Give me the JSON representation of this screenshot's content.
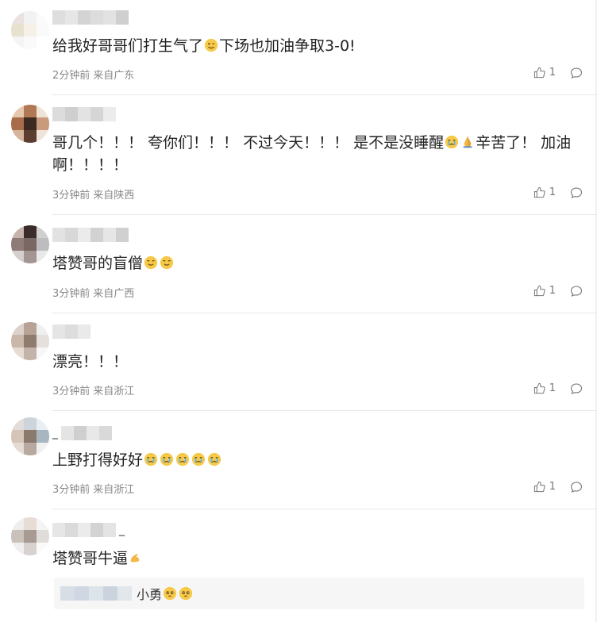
{
  "comments": [
    {
      "name_prefix": "",
      "name_suffix": "",
      "text_before": "给我好哥哥们打生气了",
      "emoji_mid": "emoji-wink",
      "text_after": "下场也加油争取3-0!",
      "time": "2分钟前",
      "location": "来自广东",
      "likes": "1"
    },
    {
      "name_prefix": "",
      "name_suffix": "",
      "text_before": "哥几个！！！ 夸你们！！！ 不过今天！！！ 是不是没睡醒",
      "emoji_mid": "emoji-cry, emoji-pray",
      "text_after": "辛苦了！ 加油啊！！！！",
      "time": "3分钟前",
      "location": "来自陕西",
      "likes": "1"
    },
    {
      "name_prefix": "",
      "name_suffix": "",
      "text_before": "塔赞哥的盲僧",
      "emoji_mid": "emoji-grin, emoji-grin",
      "text_after": "",
      "time": "3分钟前",
      "location": "来自广西",
      "likes": "1"
    },
    {
      "name_prefix": "",
      "name_suffix": "",
      "text_before": "漂亮！！！",
      "emoji_mid": "",
      "text_after": "",
      "time": "3分钟前",
      "location": "来自浙江",
      "likes": "1"
    },
    {
      "name_prefix": "_",
      "name_suffix": "",
      "text_before": "上野打得好好",
      "emoji_mid": "emoji-cry x5",
      "text_after": "",
      "time": "3分钟前",
      "location": "来自浙江",
      "likes": "1"
    },
    {
      "name_prefix": "",
      "name_suffix": "_",
      "text_before": "塔赞哥牛逼",
      "emoji_mid": "emoji-muscle",
      "text_after": "",
      "time": "",
      "location": "",
      "likes": ""
    }
  ],
  "subreply": {
    "text": "小勇",
    "emoji": "emoji-pleading, emoji-pleading"
  },
  "colors": {
    "text": "#222222",
    "meta": "#888888",
    "divider": "#e8e8e8",
    "emoji_yellow": "#f7c948"
  }
}
